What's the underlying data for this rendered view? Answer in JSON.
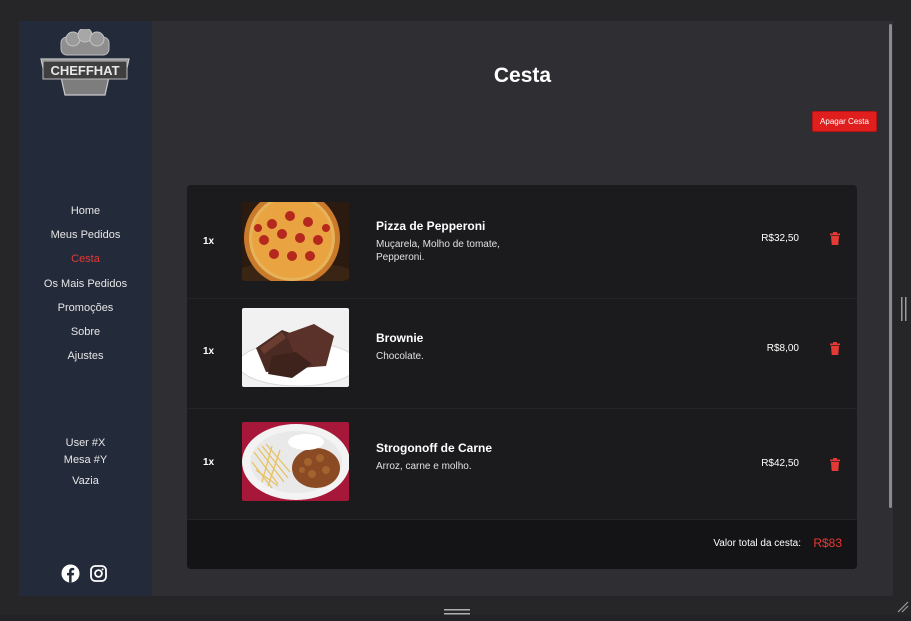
{
  "app": {
    "logo_text": "CHEFFHAT",
    "colors": {
      "accent": "#e53935",
      "sidebar_bg": "#232b3a",
      "card_bg": "#1b1b1d"
    }
  },
  "sidebar": {
    "items": [
      {
        "label": "Home",
        "active": false
      },
      {
        "label": "Meus Pedidos",
        "active": false
      },
      {
        "label": "Cesta",
        "active": true
      },
      {
        "label": "Os Mais Pedidos",
        "active": false
      },
      {
        "label": "Promoções",
        "active": false
      },
      {
        "label": "Sobre",
        "active": false
      },
      {
        "label": "Ajustes",
        "active": false
      }
    ],
    "user": "User #X",
    "table": "Mesa #Y",
    "status": "Vazia",
    "social": [
      "facebook-icon",
      "instagram-icon"
    ]
  },
  "main": {
    "title": "Cesta",
    "clear_button": "Apagar Cesta",
    "items": [
      {
        "qty": "1x",
        "name": "Pizza de Pepperoni",
        "desc_lines": [
          "Muçarela, Molho de tomate,",
          "Pepperoni."
        ],
        "price": "R$32,50",
        "image": "pizza-image"
      },
      {
        "qty": "1x",
        "name": "Brownie",
        "desc_lines": [
          "Chocolate."
        ],
        "price": "R$8,00",
        "image": "brownie-image"
      },
      {
        "qty": "1x",
        "name": "Strogonoff de Carne",
        "desc_lines": [
          "Arroz, carne e molho."
        ],
        "price": "R$42,50",
        "image": "strogonoff-image"
      }
    ],
    "total_label": "Valor total da cesta:",
    "total_value": "R$83"
  }
}
